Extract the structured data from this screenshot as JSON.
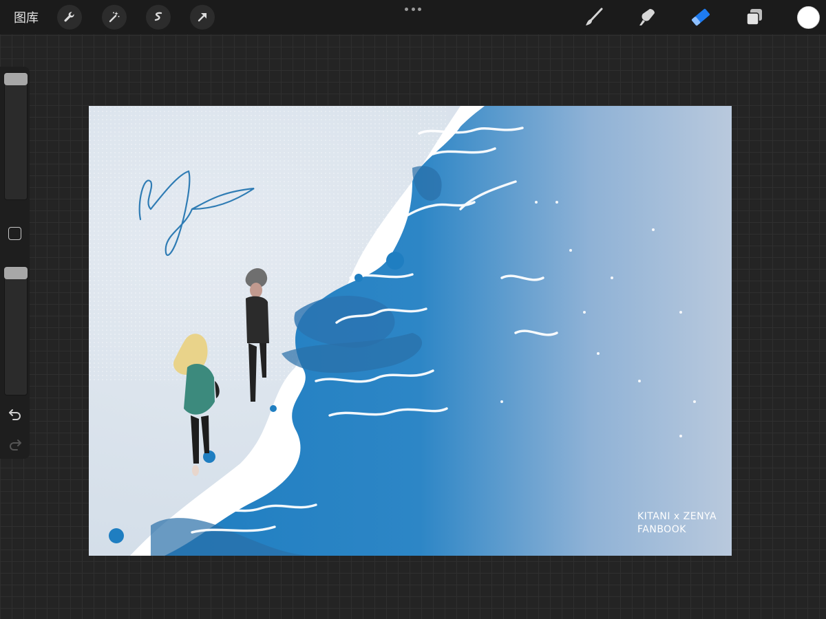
{
  "toolbar": {
    "gallery_label": "图库",
    "left_tools": [
      "wrench-icon",
      "magic-wand-icon",
      "selection-icon",
      "transform-arrow-icon"
    ],
    "more_menu": "more-dots-icon",
    "right_tools": [
      "brush-icon",
      "smudge-icon",
      "eraser-icon",
      "layers-icon"
    ],
    "active_tool": "eraser",
    "accent_color": "#1e7bf0",
    "current_color": "#ffffff"
  },
  "sidebar": {
    "brush_size_level": 0.0,
    "opacity_level": 0.0,
    "icons": [
      "modify-square-icon",
      "undo-icon",
      "redo-icon"
    ]
  },
  "canvas": {
    "signature_line1": "KITANI x ZENYA",
    "signature_line2": "FANBOOK",
    "colors": {
      "sand": "#dfe7ef",
      "foam": "#ffffff",
      "sea_deep": "#1f7ec1",
      "sea_mid": "#3d8fc8",
      "sea_light": "#b7c8dc",
      "signature_blue": "#2f7cb4"
    }
  }
}
